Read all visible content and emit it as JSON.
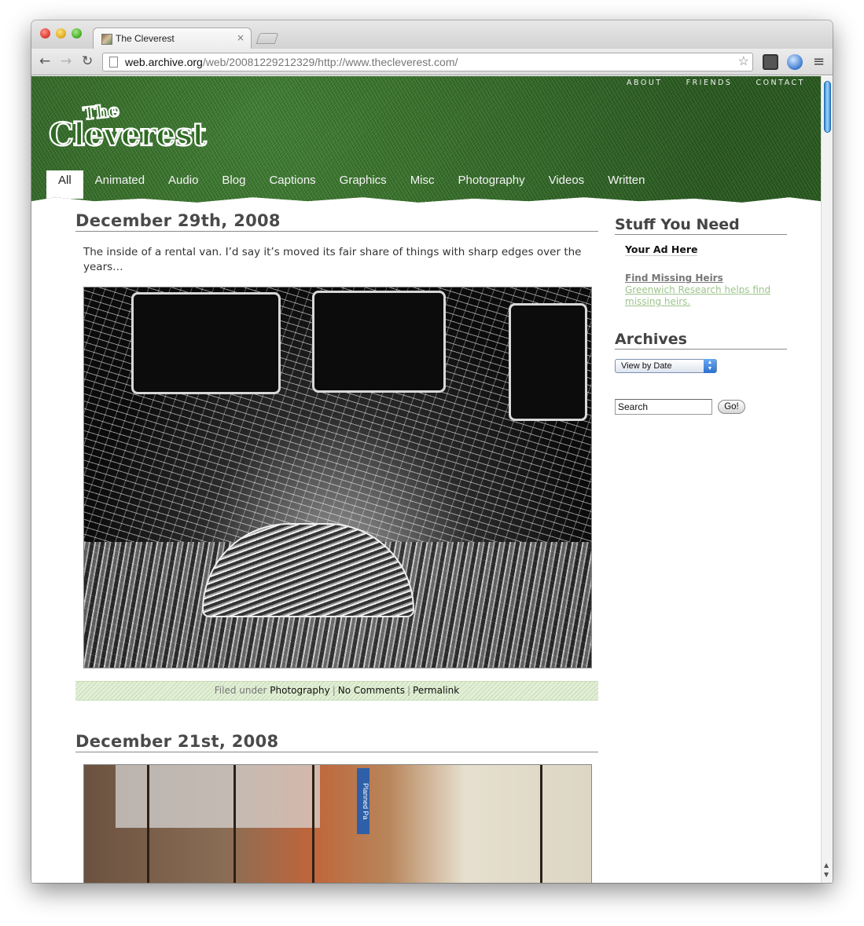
{
  "browser": {
    "tab_title": "The Cleverest",
    "tab_close": "×",
    "url_domain": "web.archive.org",
    "url_rest": "/web/20081229212329/http://www.thecleverest.com/",
    "icons": {
      "back": "back-arrow-icon",
      "forward": "forward-arrow-icon",
      "reload": "reload-icon",
      "star": "bookmark-star-icon",
      "menu": "wrench-menu-icon"
    }
  },
  "site": {
    "logo_small": "The",
    "logo_large": "Cleverest",
    "top_nav": [
      "ABOUT",
      "FRIENDS",
      "CONTACT"
    ],
    "categories": [
      "All",
      "Animated",
      "Audio",
      "Blog",
      "Captions",
      "Graphics",
      "Misc",
      "Photography",
      "Videos",
      "Written"
    ],
    "active_category": "All",
    "colors": {
      "header_green": "#2f6a23",
      "link_green": "#9cc48b"
    }
  },
  "posts": [
    {
      "date": "December 29th, 2008",
      "text": "The inside of a rental van. I’d say it’s moved its fair share of things with sharp edges over the years…",
      "filed_under_label": "Filed under",
      "category": "Photography",
      "separator": "|",
      "comments": "No Comments",
      "permalink": "Permalink"
    },
    {
      "date": "December 21st, 2008",
      "image_sign_text": "Planned Pa"
    }
  ],
  "sidebar": {
    "stuff_title": "Stuff You Need",
    "ad_here": "Your Ad Here",
    "ad2_title": "Find Missing Heirs",
    "ad2_desc": "Greenwich Research helps find missing heirs.",
    "archives_title": "Archives",
    "archives_select": "View by Date",
    "search_value": "Search",
    "go_label": "Go!"
  }
}
